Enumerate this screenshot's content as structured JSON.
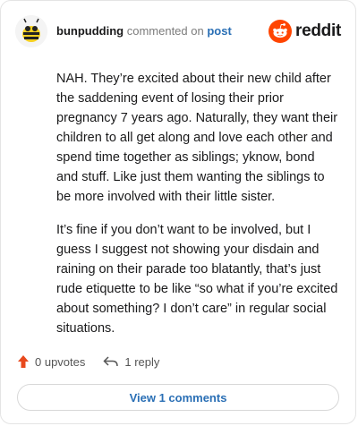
{
  "header": {
    "username": "bunpudding",
    "verb": "commented on",
    "post_link": "post",
    "logo_text": "reddit",
    "logo_color": "#ff4500"
  },
  "comment": {
    "paragraphs": [
      "NAH. They’re excited about their new child after the saddening event of losing their prior pregnancy 7 years ago. Naturally, they want their children to all get along and love each other and spend time together as siblings; yknow, bond and stuff. Like just them wanting the siblings to be more involved with their little sister.",
      "It’s fine if you don’t want to be involved, but I guess I suggest not showing your disdain and raining on their parade too blatantly, that’s just rude etiquette to be like “so what if you’re excited about something? I don’t care” in regular social situations."
    ]
  },
  "actions": {
    "upvotes": "0 upvotes",
    "replies": "1 reply",
    "upvote_color": "#e8491d"
  },
  "footer": {
    "view_comments": "View 1 comments"
  },
  "icons": [
    "avatar-bee-icon",
    "reddit-logo-icon",
    "upvote-arrow-icon",
    "reply-arrow-icon"
  ]
}
